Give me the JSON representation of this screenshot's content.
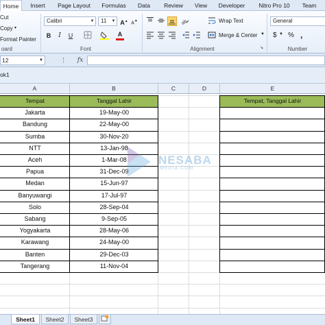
{
  "ribbon_tabs": [
    "Home",
    "Insert",
    "Page Layout",
    "Formulas",
    "Data",
    "Review",
    "View",
    "Developer",
    "Nitro Pro 10",
    "Team"
  ],
  "clipboard": {
    "cut": "Cut",
    "copy": "Copy",
    "copy_arrow": "▾",
    "format_painter": "Format Painter",
    "label": "oard"
  },
  "font": {
    "name": "Calibri",
    "size": "11",
    "label": "Font"
  },
  "alignment": {
    "wrap_text": "Wrap Text",
    "merge_center": "Merge & Center",
    "label": "Alignment"
  },
  "number": {
    "format": "General",
    "label": "Number",
    "currency": "$",
    "percent": "%",
    "comma": ","
  },
  "formula_bar": {
    "name_box": "12",
    "fx": "fx"
  },
  "workbook": {
    "name": "ok1"
  },
  "columns": [
    "A",
    "B",
    "C",
    "D",
    "E"
  ],
  "table": {
    "headers": [
      "Tempat",
      "Tanggal Lahir"
    ],
    "rows": [
      [
        "Jakarta",
        "19-May-00"
      ],
      [
        "Bandung",
        "22-May-00"
      ],
      [
        "Sumba",
        "30-Nov-20"
      ],
      [
        "NTT",
        "13-Jan-98"
      ],
      [
        "Aceh",
        "1-Mar-08"
      ],
      [
        "Papua",
        "31-Dec-09"
      ],
      [
        "Medan",
        "15-Jun-97"
      ],
      [
        "Banyuwangi",
        "17-Jul-97"
      ],
      [
        "Solo",
        "28-Sep-04"
      ],
      [
        "Sabang",
        "9-Sep-05"
      ],
      [
        "Yogyakarta",
        "28-May-06"
      ],
      [
        "Karawang",
        "24-May-00"
      ],
      [
        "Banten",
        "29-Dec-03"
      ],
      [
        "Tangerang",
        "11-Nov-04"
      ]
    ]
  },
  "target_header": "Tempat, Tanggal Lahir",
  "watermark": {
    "main": "NESABA",
    "sub": "MEDIA.COM"
  },
  "sheets": [
    "Sheet1",
    "Sheet2",
    "Sheet3"
  ],
  "colors": {
    "header_fill": "#9bbb59",
    "ribbon_bg": "#dfe8f5",
    "active_align": "#fbd56c"
  }
}
